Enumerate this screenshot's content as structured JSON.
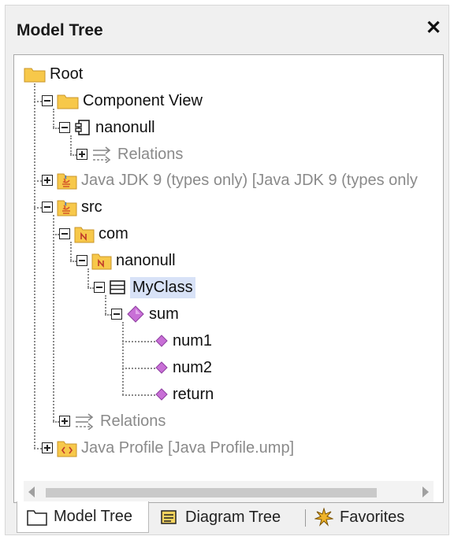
{
  "panel": {
    "title": "Model Tree",
    "close_glyph": "✕"
  },
  "tree": {
    "items": [
      {
        "label": "Root",
        "icon": "folder-icon",
        "expander": ""
      },
      {
        "label": "Component View",
        "icon": "folder-icon",
        "expander": "minus"
      },
      {
        "label": "nanonull",
        "icon": "component-icon",
        "expander": "minus"
      },
      {
        "label": "Relations",
        "icon": "relations-icon",
        "expander": "plus"
      },
      {
        "label": "Java JDK 9 (types only) [Java JDK 9 (types only",
        "icon": "java-package-icon",
        "expander": "plus"
      },
      {
        "label": "src",
        "icon": "java-package-icon",
        "expander": "minus"
      },
      {
        "label": "com",
        "icon": "namespace-package-icon",
        "expander": "minus"
      },
      {
        "label": "nanonull",
        "icon": "namespace-package-icon",
        "expander": "minus"
      },
      {
        "label": "MyClass",
        "icon": "class-icon",
        "expander": "minus",
        "selected": true
      },
      {
        "label": "sum",
        "icon": "operation-icon",
        "expander": "minus"
      },
      {
        "label": "num1",
        "icon": "parameter-icon",
        "expander": ""
      },
      {
        "label": "num2",
        "icon": "parameter-icon",
        "expander": ""
      },
      {
        "label": "return",
        "icon": "parameter-icon",
        "expander": ""
      },
      {
        "label": "Relations",
        "icon": "relations-icon",
        "expander": "plus"
      },
      {
        "label": "Java Profile [Java Profile.ump]",
        "icon": "profile-icon",
        "expander": "plus"
      }
    ]
  },
  "tabs": [
    {
      "label": "Model Tree",
      "icon": "model-tree-icon",
      "active": true
    },
    {
      "label": "Diagram Tree",
      "icon": "diagram-tree-icon",
      "active": false
    },
    {
      "label": "Favorites",
      "icon": "favorites-icon",
      "active": false
    }
  ],
  "colors": {
    "folder": "#f7c84a",
    "selection": "#d8e2f7",
    "operation": "#c86fd6",
    "gray_text": "#8a8a8a"
  }
}
